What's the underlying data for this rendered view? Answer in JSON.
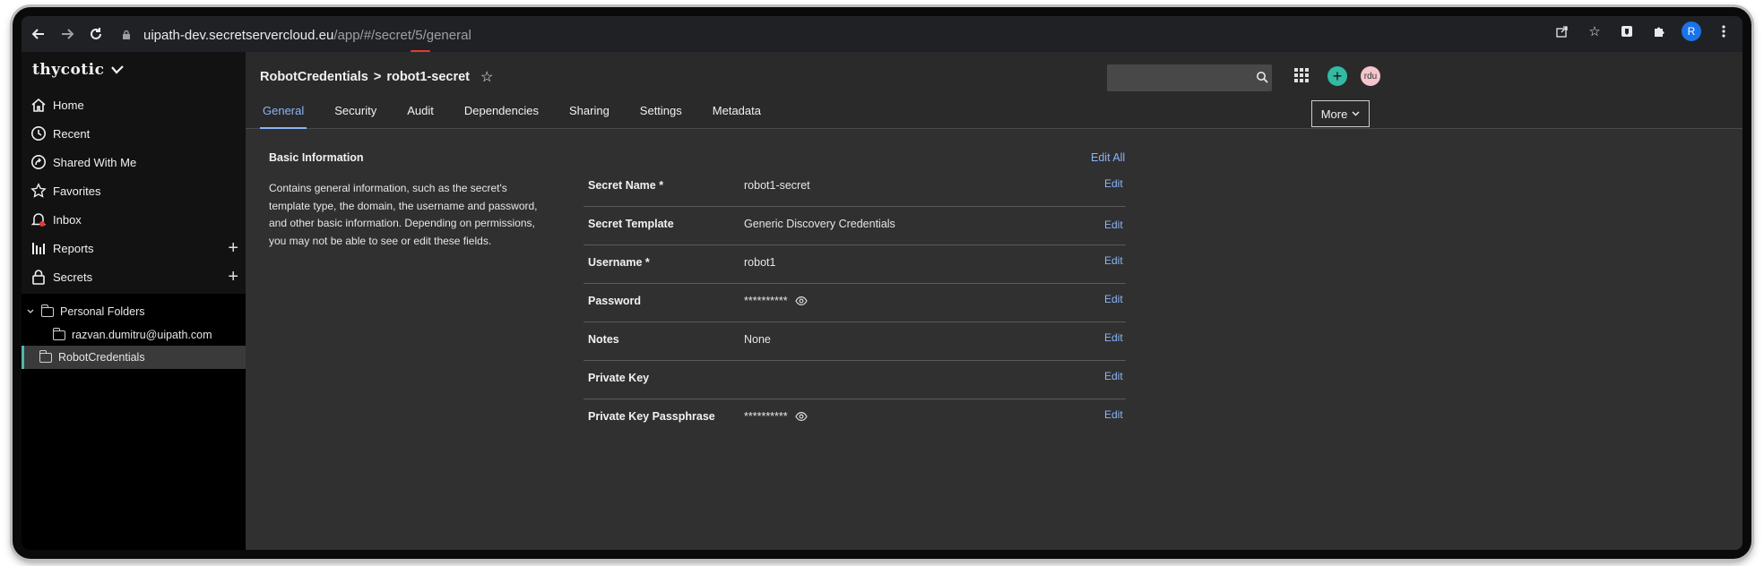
{
  "browser": {
    "url_host": "uipath-dev.secretservercloud.eu",
    "url_path": "/app/#/secret/5/general",
    "profile_initial": "R"
  },
  "sidebar": {
    "logo": "thycotic",
    "items": [
      {
        "label": "Home",
        "icon": "home-icon"
      },
      {
        "label": "Recent",
        "icon": "clock-icon"
      },
      {
        "label": "Shared With Me",
        "icon": "share-icon"
      },
      {
        "label": "Favorites",
        "icon": "star-icon"
      },
      {
        "label": "Inbox",
        "icon": "bell-icon"
      },
      {
        "label": "Reports",
        "icon": "reports-icon"
      },
      {
        "label": "Secrets",
        "icon": "lock-icon"
      }
    ],
    "folders": {
      "personal": "Personal Folders",
      "user_folder": "razvan.dumitru@uipath.com",
      "robot": "RobotCredentials"
    }
  },
  "header": {
    "breadcrumb_parent": "RobotCredentials",
    "breadcrumb_sep": ">",
    "breadcrumb_current": "robot1-secret",
    "search_placeholder": "",
    "avatar": "rdu",
    "more_label": "More"
  },
  "tabs": [
    "General",
    "Security",
    "Audit",
    "Dependencies",
    "Sharing",
    "Settings",
    "Metadata"
  ],
  "basic_info": {
    "title": "Basic Information",
    "description": "Contains general information, such as the secret's template type, the domain, the username and password, and other basic information. Depending on permissions, you may not be able to see or edit these fields.",
    "edit_all": "Edit All",
    "fields": [
      {
        "label": "Secret Name *",
        "value": "robot1-secret",
        "edit": "Edit"
      },
      {
        "label": "Secret Template",
        "value": "Generic Discovery Credentials",
        "edit": "Edit"
      },
      {
        "label": "Username *",
        "value": "robot1",
        "edit": "Edit"
      },
      {
        "label": "Password",
        "value": "**********",
        "edit": "Edit"
      },
      {
        "label": "Notes",
        "value": "None",
        "edit": "Edit"
      },
      {
        "label": "Private Key",
        "value": "",
        "edit": "Edit"
      },
      {
        "label": "Private Key Passphrase",
        "value": "**********",
        "edit": "Edit"
      }
    ]
  },
  "colors": {
    "accent_blue": "#8ab4f8",
    "teal": "#34b9a3",
    "selected_border": "#4fb8ac"
  }
}
